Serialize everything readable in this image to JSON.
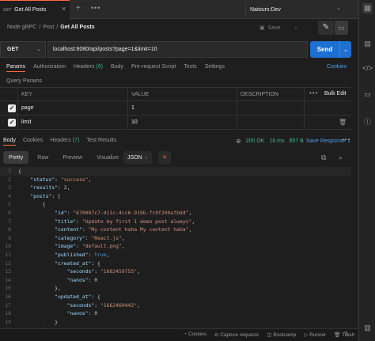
{
  "tab": {
    "method": "GET",
    "title": "Get All Posts"
  },
  "environment": {
    "name": "Natours:Dev"
  },
  "breadcrumb": [
    "Node gRPC",
    "Post",
    "Get All Posts"
  ],
  "toolbar": {
    "save_label": "Save"
  },
  "request": {
    "method": "GET",
    "url": "localhost:8080/api/posts?page=1&limit=10",
    "send_label": "Send"
  },
  "request_tabs": [
    {
      "label": "Params",
      "count": ""
    },
    {
      "label": "Authorization",
      "count": ""
    },
    {
      "label": "Headers",
      "count": "(6)"
    },
    {
      "label": "Body",
      "count": ""
    },
    {
      "label": "Pre-request Script",
      "count": ""
    },
    {
      "label": "Tests",
      "count": ""
    },
    {
      "label": "Settings",
      "count": ""
    }
  ],
  "cookies_label": "Cookies",
  "query_params_title": "Query Params",
  "params_headers": {
    "key": "KEY",
    "value": "VALUE",
    "description": "DESCRIPTION",
    "bulk_edit": "Bulk Edit"
  },
  "params": [
    {
      "key": "page",
      "value": "1",
      "checked": true
    },
    {
      "key": "limit",
      "value": "10",
      "checked": true
    }
  ],
  "response_tabs": [
    {
      "label": "Body",
      "count": ""
    },
    {
      "label": "Cookies",
      "count": ""
    },
    {
      "label": "Headers",
      "count": "(7)"
    },
    {
      "label": "Test Results",
      "count": ""
    }
  ],
  "response_status": {
    "code": "200 OK",
    "time": "16 ms",
    "size": "857 B",
    "save_label": "Save Response"
  },
  "format_tabs": [
    "Pretty",
    "Raw",
    "Preview",
    "Visualize"
  ],
  "language": "JSON",
  "code_lines": [
    "{",
    "    \"status\": \"success\",",
    "    \"results\": 2,",
    "    \"posts\": [",
    "        {",
    "            \"id\": \"670007c7-d11c-4cc6-919b-fc9f200afbd4\",",
    "            \"title\": \"Update my first 1 demo post always\",",
    "            \"content\": \"My content haha My content haha\",",
    "            \"category\": \"React.js\",",
    "            \"image\": \"default.png\",",
    "            \"published\": true,",
    "            \"created_at\": {",
    "                \"seconds\": \"1662459755\",",
    "                \"nanos\": 0",
    "            },",
    "            \"updated_at\": {",
    "                \"seconds\": \"1662460442\",",
    "                \"nanos\": 0",
    "            }",
    "        },",
    "        {"
  ],
  "status_bar": [
    "Cookies",
    "Capture requests",
    "Bootcamp",
    "Runner",
    "Trash"
  ],
  "colors": {
    "accent": "#ff6c37",
    "send": "#1d6fd1",
    "ok": "#41b883",
    "link": "#4f9ee8"
  }
}
